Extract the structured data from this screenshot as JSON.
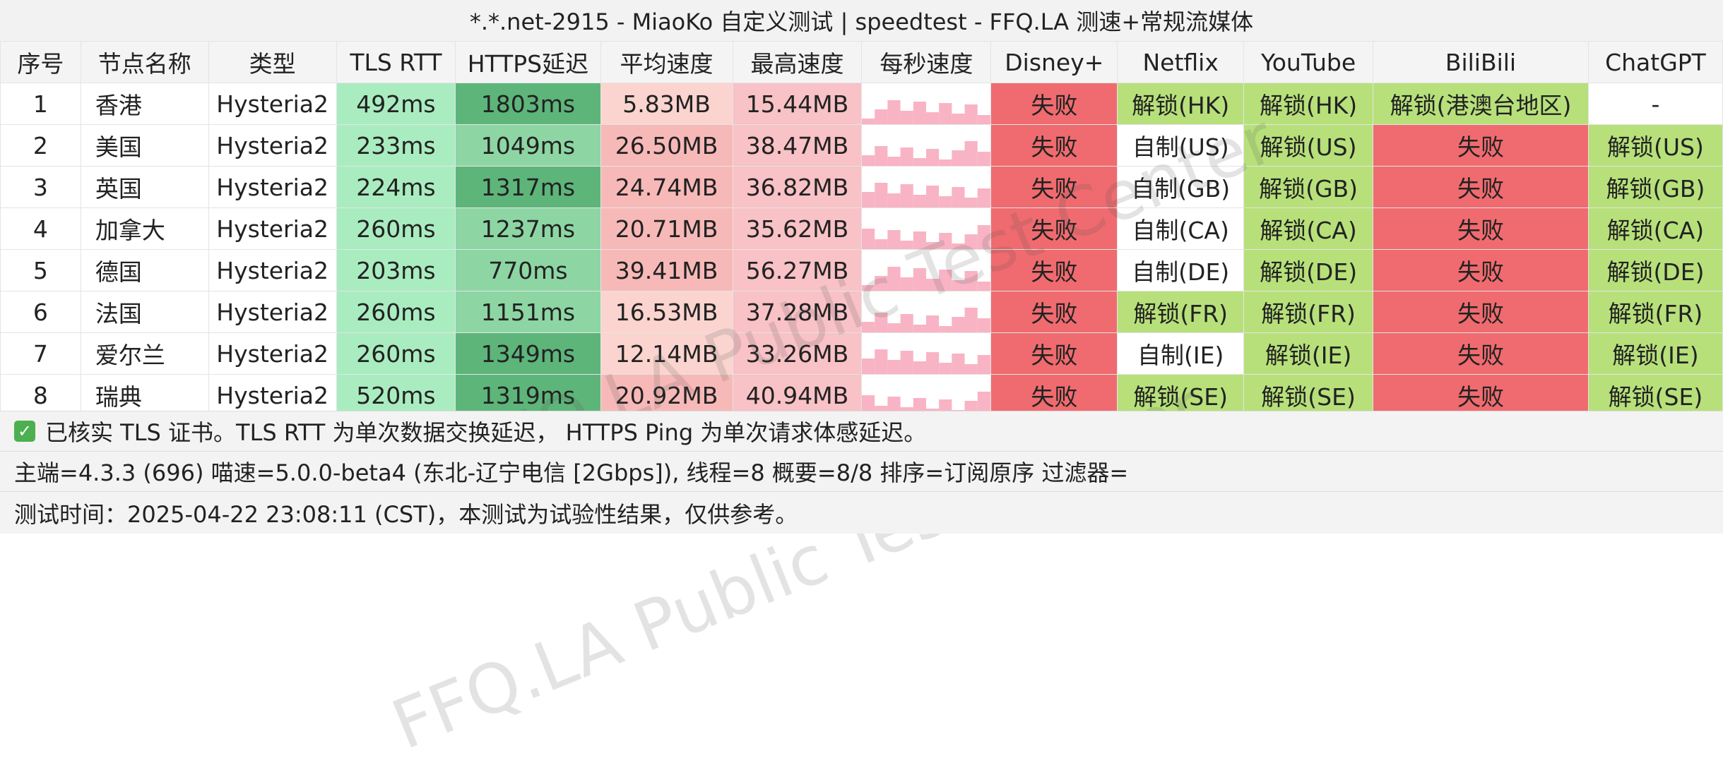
{
  "title": "*.*.net-2915 - MiaoKo 自定义测试 | speedtest - FFQ.LA 测速+常规流媒体",
  "watermark": "FFQ.LA Public Test Center",
  "columns": [
    "序号",
    "节点名称",
    "类型",
    "TLS RTT",
    "HTTPS延迟",
    "平均速度",
    "最高速度",
    "每秒速度",
    "Disney+",
    "Netflix",
    "YouTube",
    "BiliBili",
    "ChatGPT"
  ],
  "rows": [
    {
      "id": "1",
      "name": "香港",
      "type": "Hysteria2",
      "tls": "492ms",
      "https": "1803ms",
      "avg": "5.83MB",
      "max": "15.44MB",
      "disney": "失败",
      "netflix": "解锁(HK)",
      "youtube": "解锁(HK)",
      "bili": "解锁(港澳台地区)",
      "chatgpt": "-"
    },
    {
      "id": "2",
      "name": "美国",
      "type": "Hysteria2",
      "tls": "233ms",
      "https": "1049ms",
      "avg": "26.50MB",
      "max": "38.47MB",
      "disney": "失败",
      "netflix": "自制(US)",
      "youtube": "解锁(US)",
      "bili": "失败",
      "chatgpt": "解锁(US)"
    },
    {
      "id": "3",
      "name": "英国",
      "type": "Hysteria2",
      "tls": "224ms",
      "https": "1317ms",
      "avg": "24.74MB",
      "max": "36.82MB",
      "disney": "失败",
      "netflix": "自制(GB)",
      "youtube": "解锁(GB)",
      "bili": "失败",
      "chatgpt": "解锁(GB)"
    },
    {
      "id": "4",
      "name": "加拿大",
      "type": "Hysteria2",
      "tls": "260ms",
      "https": "1237ms",
      "avg": "20.71MB",
      "max": "35.62MB",
      "disney": "失败",
      "netflix": "自制(CA)",
      "youtube": "解锁(CA)",
      "bili": "失败",
      "chatgpt": "解锁(CA)"
    },
    {
      "id": "5",
      "name": "德国",
      "type": "Hysteria2",
      "tls": "203ms",
      "https": "770ms",
      "avg": "39.41MB",
      "max": "56.27MB",
      "disney": "失败",
      "netflix": "自制(DE)",
      "youtube": "解锁(DE)",
      "bili": "失败",
      "chatgpt": "解锁(DE)"
    },
    {
      "id": "6",
      "name": "法国",
      "type": "Hysteria2",
      "tls": "260ms",
      "https": "1151ms",
      "avg": "16.53MB",
      "max": "37.28MB",
      "disney": "失败",
      "netflix": "解锁(FR)",
      "youtube": "解锁(FR)",
      "bili": "失败",
      "chatgpt": "解锁(FR)"
    },
    {
      "id": "7",
      "name": "爱尔兰",
      "type": "Hysteria2",
      "tls": "260ms",
      "https": "1349ms",
      "avg": "12.14MB",
      "max": "33.26MB",
      "disney": "失败",
      "netflix": "自制(IE)",
      "youtube": "解锁(IE)",
      "bili": "失败",
      "chatgpt": "解锁(IE)"
    },
    {
      "id": "8",
      "name": "瑞典",
      "type": "Hysteria2",
      "tls": "520ms",
      "https": "1319ms",
      "avg": "20.92MB",
      "max": "40.94MB",
      "disney": "失败",
      "netflix": "解锁(SE)",
      "youtube": "解锁(SE)",
      "bili": "失败",
      "chatgpt": "解锁(SE)"
    }
  ],
  "footer": {
    "note": "已核实 TLS 证书。TLS RTT 为单次数据交换延迟， HTTPS Ping 为单次请求体感延迟。",
    "info": "主端=4.3.3 (696) 喵速=5.0.0-beta4 (东北-辽宁电信 [2Gbps]), 线程=8 概要=8/8 排序=订阅原序 过滤器=",
    "time": "测试时间：2025-04-22 23:08:11 (CST)，本测试为试验性结果，仅供参考。"
  },
  "colors": {
    "fail": "#ef6b6f",
    "unlock": "#b7e07a",
    "original": "#ffffff",
    "tls_bg": "#a9ecc0",
    "https_dark": "#5db57a",
    "https_light": "#8dd6a4",
    "avg_light": "#fbd4cf",
    "avg_mid": "#f7b9b8",
    "max_bg": "#f8c2c6",
    "spark": "#f8b4c4"
  }
}
